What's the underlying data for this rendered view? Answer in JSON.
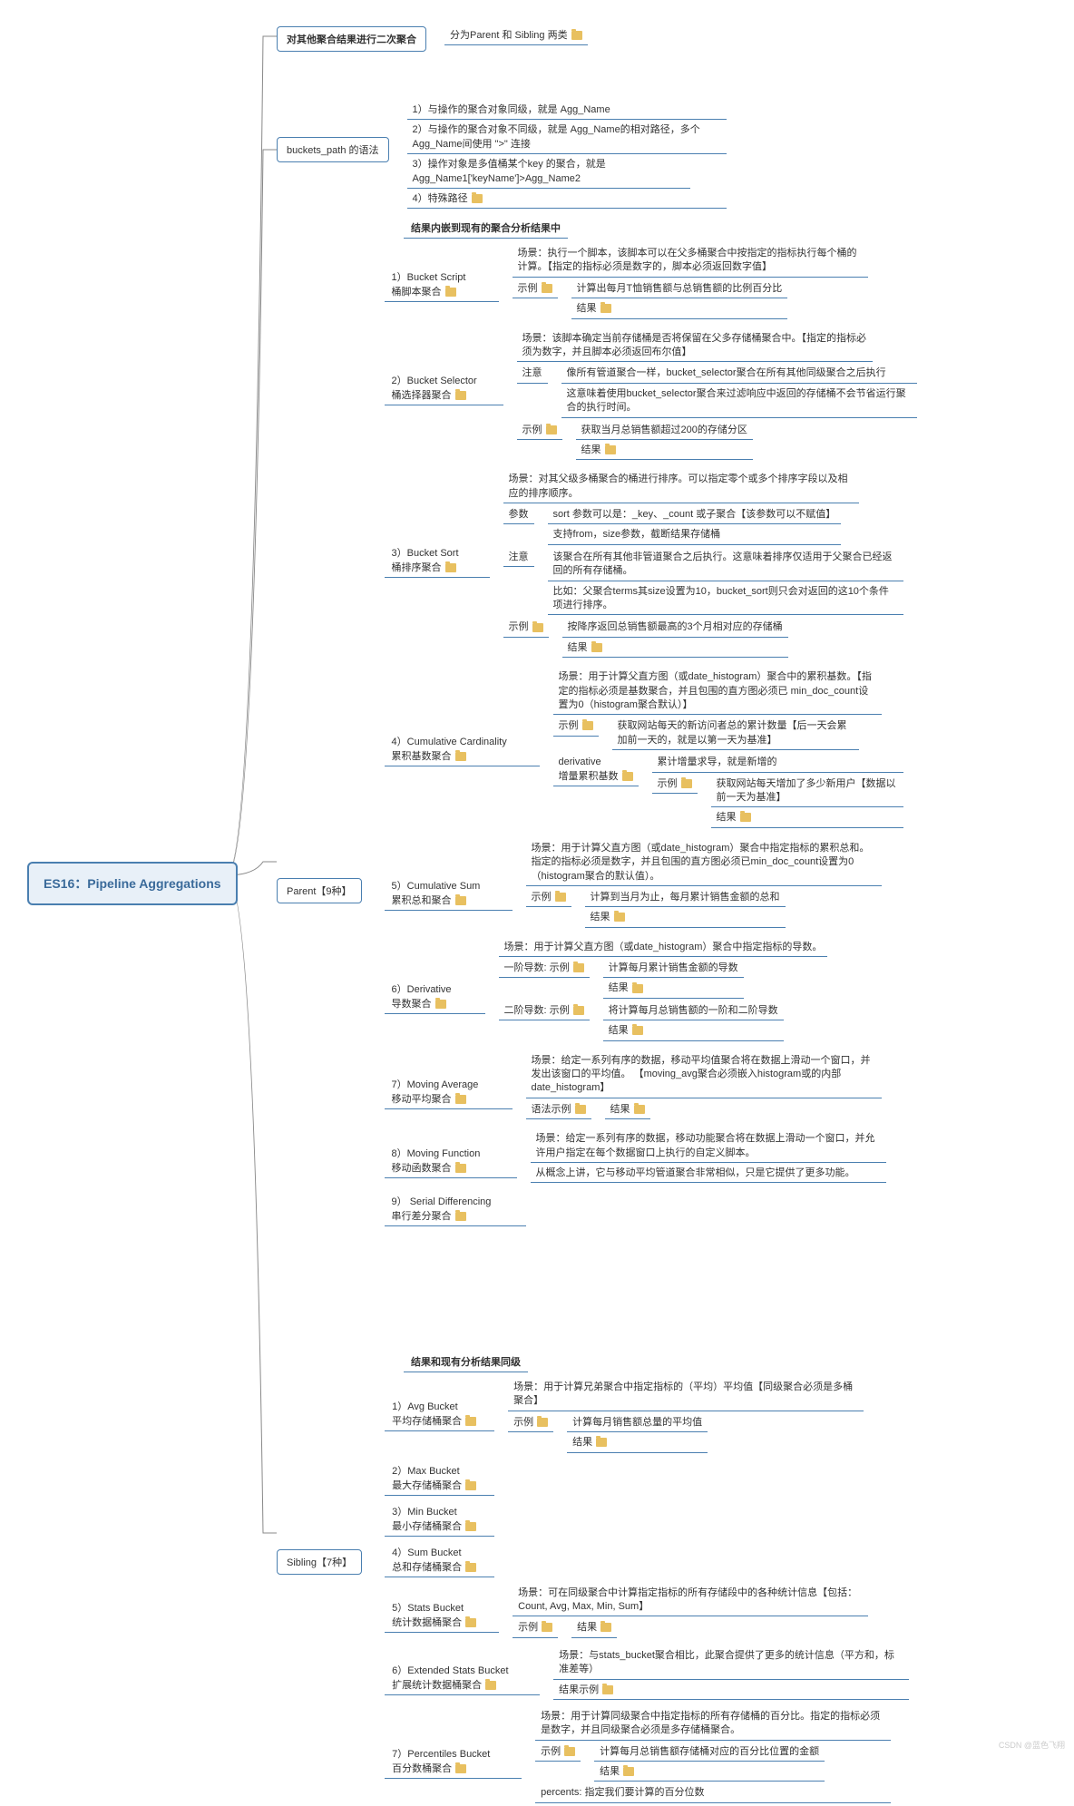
{
  "root": "ES16：Pipeline Aggregations",
  "b1": {
    "title": "对其他聚合结果进行二次聚合",
    "c1": "分为Parent 和 Sibling 两类"
  },
  "b2": {
    "title": "buckets_path 的语法",
    "i1": "1）与操作的聚合对象同级，就是 Agg_Name",
    "i2": "2）与操作的聚合对象不同级，就是 Agg_Name的相对路径，多个 Agg_Name间使用 \">\" 连接",
    "i3": "3）操作对象是多值桶某个key 的聚合，就是Agg_Name1['keyName']>Agg_Name2",
    "i4": "4）特殊路径"
  },
  "parent": {
    "title": "Parent【9种】",
    "header": "结果内嵌到现有的聚合分析结果中",
    "p1": {
      "t": "1）Bucket Script\n桶脚本聚合",
      "scene": "场景：执行一个脚本，该脚本可以在父多桶聚合中按指定的指标执行每个桶的计算。【指定的指标必须是数字的，脚本必须返回数字值】",
      "ex": "示例",
      "ex1": "计算出每月T恤销售额与总销售额的比例百分比",
      "res": "结果"
    },
    "p2": {
      "t": "2）Bucket Selector\n桶选择器聚合",
      "scene": "场景：该脚本确定当前存储桶是否将保留在父多存储桶聚合中。【指定的指标必须为数字，并且脚本必须返回布尔值】",
      "note": "注意",
      "n1": "像所有管道聚合一样，bucket_selector聚合在所有其他同级聚合之后执行",
      "n2": "这意味着使用bucket_selector聚合来过滤响应中返回的存储桶不会节省运行聚合的执行时间。",
      "ex": "示例",
      "ex1": "获取当月总销售额超过200的存储分区",
      "res": "结果"
    },
    "p3": {
      "t": "3）Bucket Sort\n桶排序聚合",
      "scene": "场景：对其父级多桶聚合的桶进行排序。可以指定零个或多个排序字段以及相应的排序顺序。",
      "param": "参数",
      "pa1": "sort 参数可以是：_key、_count 或子聚合【该参数可以不赋值】",
      "pa2": "支持from，size参数，截断结果存储桶",
      "note": "注意",
      "n1": "该聚合在所有其他非管道聚合之后执行。这意味着排序仅适用于父聚合已经返回的所有存储桶。",
      "n2": "比如：父聚合terms其size设置为10，bucket_sort则只会对返回的这10个条件项进行排序。",
      "ex": "示例",
      "ex1": "按降序返回总销售额最高的3个月相对应的存储桶",
      "res": "结果"
    },
    "p4": {
      "t": "4）Cumulative Cardinality\n累积基数聚合",
      "scene": "场景：用于计算父直方图（或date_histogram）聚合中的累积基数。【指定的指标必须是基数聚合，并且包围的直方图必须已 min_doc_count设置为0（histogram聚合默认）】",
      "ex": "示例",
      "ex1": "获取网站每天的新访问者总的累计数量【后一天会累加前一天的，就是以第一天为基准】",
      "der": "derivative\n增量累积基数",
      "d1": "累计增量求导，就是新增的",
      "dex": "示例",
      "dex1": "获取网站每天增加了多少新用户【数据以前一天为基准】",
      "res": "结果"
    },
    "p5": {
      "t": "5）Cumulative Sum\n累积总和聚合",
      "scene": "场景：用于计算父直方图（或date_histogram）聚合中指定指标的累积总和。指定的指标必须是数字，并且包围的直方图必须已min_doc_count设置为0（histogram聚合的默认值）。",
      "ex": "示例",
      "ex1": "计算到当月为止，每月累计销售金额的总和",
      "res": "结果"
    },
    "p6": {
      "t": "6）Derivative\n导数聚合",
      "scene": "场景：用于计算父直方图（或date_histogram）聚合中指定指标的导数。",
      "d1": "一阶导数: 示例",
      "d1a": "计算每月累计销售金额的导数",
      "d1r": "结果",
      "d2": "二阶导数: 示例",
      "d2a": "将计算每月总销售额的一阶和二阶导数",
      "d2r": "结果"
    },
    "p7": {
      "t": "7）Moving Average\n移动平均聚合",
      "scene": "场景：给定一系列有序的数据，移动平均值聚合将在数据上滑动一个窗口，并发出该窗口的平均值。 【moving_avg聚合必须嵌入histogram或的内部date_histogram】",
      "syn": "语法示例",
      "res": "结果"
    },
    "p8": {
      "t": "8）Moving Function\n移动函数聚合",
      "scene": "场景：给定一系列有序的数据，移动功能聚合将在数据上滑动一个窗口，并允许用户指定在每个数据窗口上执行的自定义脚本。",
      "note": "从概念上讲，它与移动平均管道聚合非常相似，只是它提供了更多功能。"
    },
    "p9": {
      "t": "9） Serial Differencing\n串行差分聚合"
    }
  },
  "sibling": {
    "title": "Sibling【7种】",
    "header": "结果和现有分析结果同级",
    "s1": {
      "t": "1）Avg Bucket\n平均存储桶聚合",
      "scene": "场景：用于计算兄弟聚合中指定指标的（平均）平均值【同级聚合必须是多桶聚合】",
      "ex": "示例",
      "ex1": "计算每月销售额总量的平均值",
      "res": "结果"
    },
    "s2": {
      "t": "2）Max Bucket\n最大存储桶聚合"
    },
    "s3": {
      "t": "3）Min Bucket\n最小存储桶聚合"
    },
    "s4": {
      "t": "4）Sum Bucket\n总和存储桶聚合"
    },
    "s5": {
      "t": "5）Stats Bucket\n统计数据桶聚合",
      "scene": "场景：可在同级聚合中计算指定指标的所有存储段中的各种统计信息【包括：Count, Avg, Max, Min, Sum】",
      "ex": "示例",
      "res": "结果"
    },
    "s6": {
      "t": "6）Extended Stats Bucket\n扩展统计数据桶聚合",
      "scene": "场景：与stats_bucket聚合相比，此聚合提供了更多的统计信息（平方和，标准差等）",
      "res": "结果示例"
    },
    "s7": {
      "t": "7）Percentiles Bucket\n百分数桶聚合",
      "scene": "场景：用于计算同级聚合中指定指标的所有存储桶的百分比。指定的指标必须是数字，并且同级聚合必须是多存储桶聚合。",
      "ex": "示例",
      "ex1": "计算每月总销售额存储桶对应的百分比位置的金额",
      "res": "结果",
      "pc": "percents: 指定我们要计算的百分位数"
    }
  },
  "watermark": "CSDN @蓝色飞翔"
}
